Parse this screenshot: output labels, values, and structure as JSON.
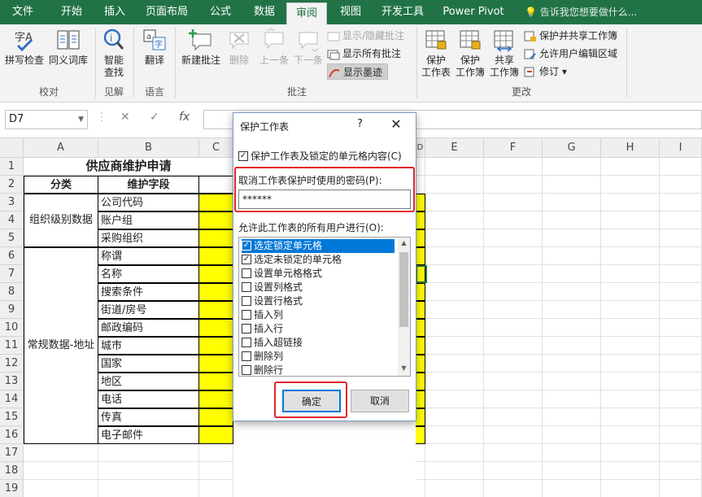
{
  "tabs": [
    "文件",
    "开始",
    "插入",
    "页面布局",
    "公式",
    "数据",
    "审阅",
    "视图",
    "开发工具",
    "Power Pivot"
  ],
  "tell_me": "告诉我您想要做什么...",
  "ribbon": {
    "spell": "拼写检查",
    "thesaurus": "同义词库",
    "proofing": "校对",
    "smart1": "智能",
    "smart2": "查找",
    "insights": "见解",
    "translate": "翻译",
    "language": "语言",
    "new_comment": "新建批注",
    "delete": "删除",
    "prev": "上一条",
    "next": "下一条",
    "show_hide": "显示/隐藏批注",
    "show_all": "显示所有批注",
    "show_ink": "显示墨迹",
    "comments": "批注",
    "protect_sheet_1": "保护",
    "protect_sheet_2": "工作表",
    "protect_book_1": "保护",
    "protect_book_2": "工作簿",
    "share_book_1": "共享",
    "share_book_2": "工作簿",
    "protect_share": "保护并共享工作簿",
    "allow_edit": "允许用户编辑区域",
    "track": "修订",
    "changes": "更改"
  },
  "formula_bar": {
    "name_box": "D7",
    "cancel": "✕",
    "enter": "✓",
    "fx": "fx"
  },
  "columns": [
    "A",
    "B",
    "C",
    "D",
    "E",
    "F",
    "G",
    "H",
    "I"
  ],
  "rows": [
    "1",
    "2",
    "3",
    "4",
    "5",
    "6",
    "7",
    "8",
    "9",
    "10",
    "11",
    "12",
    "13",
    "14",
    "15",
    "16",
    "17",
    "18",
    "19"
  ],
  "sheet": {
    "title": "供应商维护申请",
    "h_cat": "分类",
    "h_field": "维护字段",
    "cat1": "组织级别数据",
    "cat2": "常规数据-地址",
    "fields": [
      "公司代码",
      "账户组",
      "采购组织",
      "称谓",
      "名称",
      "搜索条件",
      "街道/房号",
      "邮政编码",
      "城市",
      "国家",
      "地区",
      "电话",
      "传真",
      "电子邮件"
    ]
  },
  "dialog": {
    "title": "保护工作表",
    "help": "?",
    "close": "✕",
    "protect_check": "保护工作表及锁定的单元格内容(C)",
    "pwd_label": "取消工作表保护时使用的密码(P):",
    "pwd_value": "******",
    "allow_label": "允许此工作表的所有用户进行(O):",
    "options": [
      {
        "label": "选定锁定单元格",
        "checked": true
      },
      {
        "label": "选定未锁定的单元格",
        "checked": true
      },
      {
        "label": "设置单元格格式",
        "checked": false
      },
      {
        "label": "设置列格式",
        "checked": false
      },
      {
        "label": "设置行格式",
        "checked": false
      },
      {
        "label": "插入列",
        "checked": false
      },
      {
        "label": "插入行",
        "checked": false
      },
      {
        "label": "插入超链接",
        "checked": false
      },
      {
        "label": "删除列",
        "checked": false
      },
      {
        "label": "删除行",
        "checked": false
      }
    ],
    "ok": "确定",
    "cancel": "取消"
  },
  "colors": {
    "accent": "#217346",
    "highlight": "#ffff00",
    "selection": "#0078d7",
    "annotation": "#e0242b"
  }
}
